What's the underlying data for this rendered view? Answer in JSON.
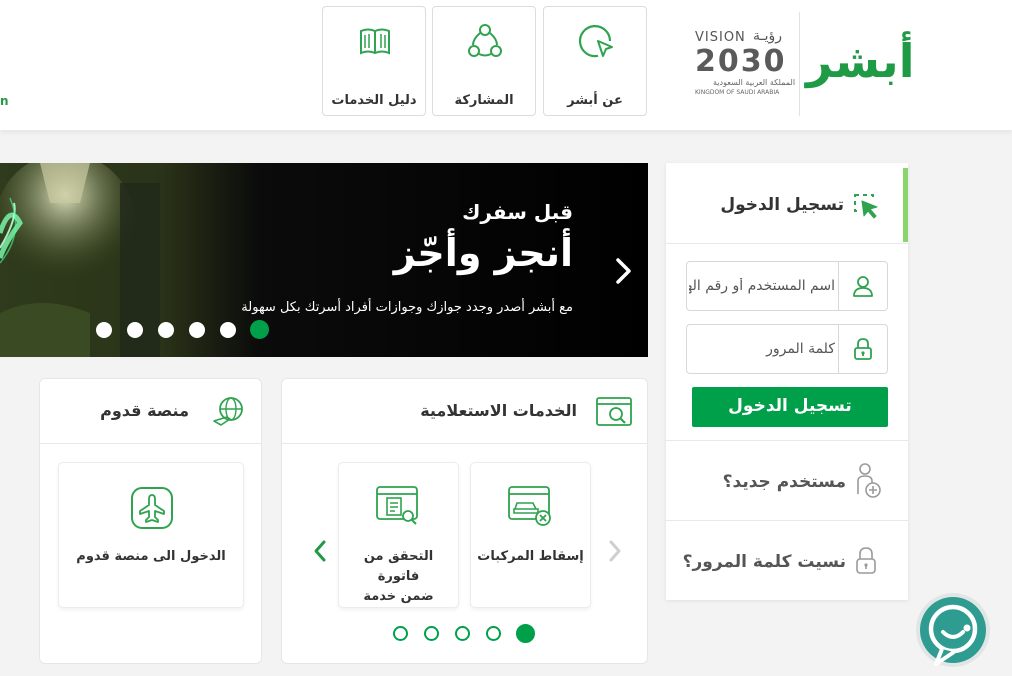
{
  "header": {
    "nav": [
      {
        "label": "عن أبشر",
        "icon": "cursor-circle-icon"
      },
      {
        "label": "المشاركة",
        "icon": "share-nodes-icon"
      },
      {
        "label": "دليل الخدمات",
        "icon": "book-icon"
      }
    ],
    "edge_link": "n",
    "logo": {
      "brand": "أبشر",
      "vision_word": "VISION",
      "vision_ar": "رؤيـة",
      "vision_year": "2030",
      "kingdom_ar": "المملكة العربية السعودية",
      "kingdom_en": "KINGDOM OF SAUDI ARABIA"
    }
  },
  "banner": {
    "subtitle": "قبل سفرك",
    "title": "أنجز وأجّز",
    "description": "مع أبشر أصدر وجدد جوازك وجوازات أفراد أسرتك بكل سهولة",
    "slide_count": 6,
    "active_slide": 1
  },
  "inquiry": {
    "title": "الخدمات الاستعلامية",
    "tiles": [
      {
        "label": "إسقاط المركبات",
        "icon": "vehicle-remove-icon"
      },
      {
        "label": "التحقق من فاتورة ضمن خدمة فرجت",
        "icon": "invoice-search-icon"
      }
    ],
    "dot_count": 5,
    "active_dot": 1
  },
  "qudoom": {
    "title": "منصة قدوم",
    "tile_label": "الدخول الى منصة قدوم",
    "icon": "airplane-icon"
  },
  "login": {
    "header": "تسجيل الدخول",
    "username_placeholder": "اسم المستخدم أو رقم الهوية",
    "password_placeholder": "كلمة المرور",
    "submit": "تسجيل الدخول",
    "new_user": "مستخدم جديد؟",
    "forgot": "نسيت كلمة المرور؟"
  },
  "colors": {
    "brand_green": "#00a04a",
    "accent_light_green": "#8ad46c",
    "banner_bg": "#050505",
    "chat_teal": "#2e9c90"
  }
}
